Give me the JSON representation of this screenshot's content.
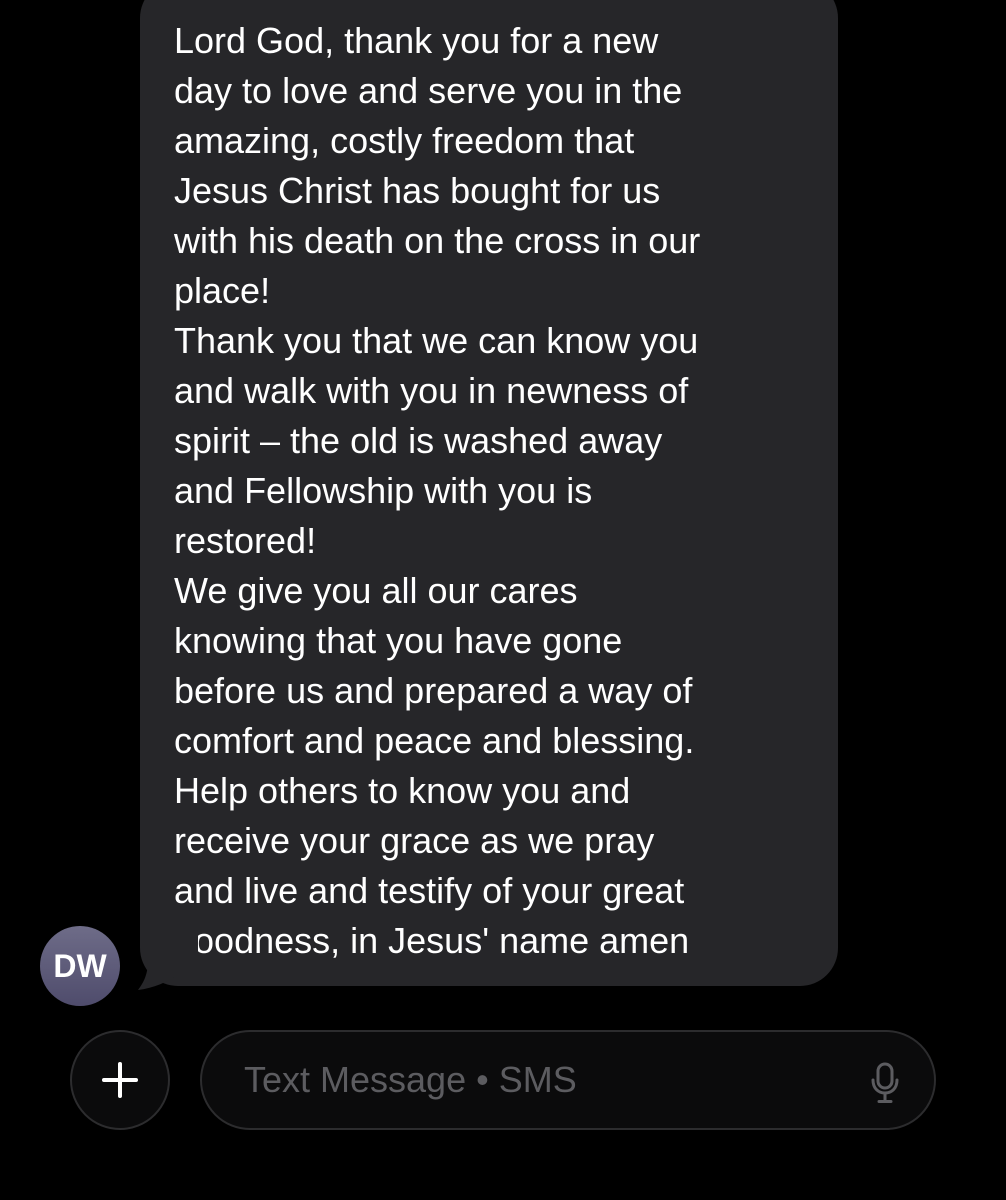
{
  "conversation": {
    "message": {
      "sender_initials": "DW",
      "text": "Lord God, thank you for a new\nday to love and serve you in the\namazing, costly freedom that\nJesus Christ has bought for us\nwith his death on the cross in our\nplace!\nThank you that we can know you\nand walk with you in newness of\nspirit – the old is washed away\nand Fellowship with you is\nrestored!\nWe give you all our cares\nknowing that you have gone\nbefore us and prepared a way of\ncomfort and peace and blessing.\nHelp others to know you and\nreceive your grace as we pray\nand live and testify of your great\ngoodness, in Jesus' name amen"
    }
  },
  "composer": {
    "placeholder": "Text Message • SMS",
    "add_icon": "plus-icon",
    "mic_icon": "microphone-icon"
  },
  "colors": {
    "background": "#000000",
    "bubble": "#262629",
    "avatar": "#5b5878",
    "placeholder": "#5c5c60"
  }
}
